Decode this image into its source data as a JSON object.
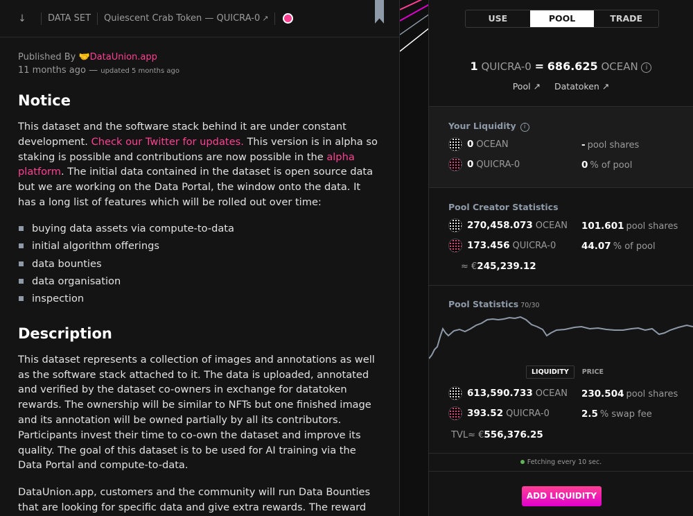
{
  "header": {
    "asset_type": "DATA SET",
    "asset_title": "Quiescent Crab Token — QUICRA-0",
    "external_icon": "↗"
  },
  "meta": {
    "published_by_label": "Published By",
    "publisher_emoji": "🤝",
    "publisher": "DataUnion.app",
    "created": "11 months ago",
    "updated_prefix": "—",
    "updated": "updated 5 months ago"
  },
  "article": {
    "notice_heading": "Notice",
    "notice_p1_a": "This dataset and the software stack behind it are under constant development. ",
    "notice_link_twitter": "Check our Twitter for updates.",
    "notice_p1_b": " This version is in alpha so staking is possible and contributions are now possible in the ",
    "notice_link_alpha": "alpha platform",
    "notice_p1_c": ". The initial data contained in the dataset is open source data but we are working on the Data Portal, the window onto the data. It has a long list of features which will be rolled out over time:",
    "features": [
      "buying data assets via compute-to-data",
      "initial algorithm offerings",
      "data bounties",
      "data organisation",
      "inspection"
    ],
    "description_heading": "Description",
    "description_p1": "This dataset represents a collection of images and annotations as well as the software stack attached to it. The data is uploaded, annotated and verified by the dataset co-owners in exchange for datatoken rewards. The ownership will be similar to NFTs but one finished image and its annotation will be owned partially by all its contributors. Participants invest their time to co-own the dataset and improve its quality. The goal of this dataset is to be used for AI training via the Data Portal and compute-to-data.",
    "description_p2": "DataUnion.app, customers and the community will run Data Bounties that are looking for specific data and give extra rewards. The reward distributions will be in intervals and not directly for now but these"
  },
  "tabs": [
    "USE",
    "POOL",
    "TRADE"
  ],
  "active_tab": "POOL",
  "price": {
    "amount": "1",
    "token": "QUICRA-0",
    "equals": "=",
    "value": "686.625",
    "base": "OCEAN",
    "info_icon": "i"
  },
  "links": {
    "pool": "Pool ↗",
    "datatoken": "Datatoken ↗"
  },
  "your_liquidity": {
    "title": "Your Liquidity",
    "ocean_amount": "0",
    "ocean_label": "OCEAN",
    "token_amount": "0",
    "token_label": "QUICRA-0",
    "pool_shares_value": "-",
    "pool_shares_label": "pool shares",
    "pct_value": "0",
    "pct_label": "% of pool"
  },
  "pool_creator": {
    "title": "Pool Creator Statistics",
    "ocean_amount": "270,458.073",
    "ocean_label": "OCEAN",
    "token_amount": "173.456",
    "token_label": "QUICRA-0",
    "pool_shares_value": "101.601",
    "pool_shares_label": "pool shares",
    "pct_value": "44.07",
    "pct_label": "% of pool",
    "euro_prefix": "≈ €",
    "euro_value": "245,239.12"
  },
  "pool_stats": {
    "title": "Pool Statistics",
    "ratio": "70/30",
    "chart_tabs": [
      "LIQUIDITY",
      "PRICE"
    ],
    "ocean_amount": "613,590.733",
    "ocean_label": "OCEAN",
    "token_amount": "393.52",
    "token_label": "QUICRA-0",
    "pool_shares_value": "230.504",
    "pool_shares_label": "pool shares",
    "swap_fee_value": "2.5",
    "swap_fee_label": "% swap fee",
    "tvl_label": "TVL",
    "tvl_prefix": "≈ €",
    "tvl_value": "556,376.25"
  },
  "fetching": "Fetching every 10 sec.",
  "add_liquidity": "ADD LIQUIDITY",
  "colors": {
    "accent": "#ff4092",
    "background": "#141414",
    "secondary": "#8e9aa8"
  }
}
